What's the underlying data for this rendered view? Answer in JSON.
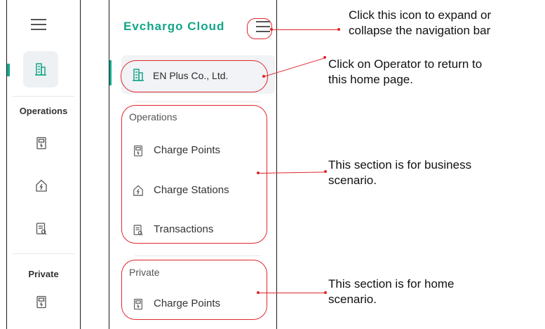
{
  "collapsed_nav": {
    "sections": [
      {
        "label": "Operations"
      },
      {
        "label": "Private"
      }
    ]
  },
  "expanded_nav": {
    "brand": "Evchargo Cloud",
    "operator": "EN Plus Co., Ltd.",
    "operations": {
      "label": "Operations",
      "items": [
        {
          "label": "Charge Points",
          "icon": "charge-point-icon"
        },
        {
          "label": "Charge Stations",
          "icon": "charge-station-icon"
        },
        {
          "label": "Transactions",
          "icon": "transactions-icon"
        }
      ]
    },
    "private": {
      "label": "Private",
      "items": [
        {
          "label": "Charge Points",
          "icon": "charge-point-icon"
        }
      ]
    }
  },
  "annotations": {
    "menu": {
      "line1": "Click this icon to expand or",
      "line2": "collapse the navigation bar"
    },
    "operator": {
      "line1": "Click on Operator to return to",
      "line2": "this home page."
    },
    "business": {
      "line1": "This section is for business",
      "line2": "scenario."
    },
    "home": {
      "line1": "This section is for home",
      "line2": "scenario."
    }
  },
  "colors": {
    "brand": "#12a587",
    "annotation": "#e0262b",
    "active": "#14a98a"
  }
}
